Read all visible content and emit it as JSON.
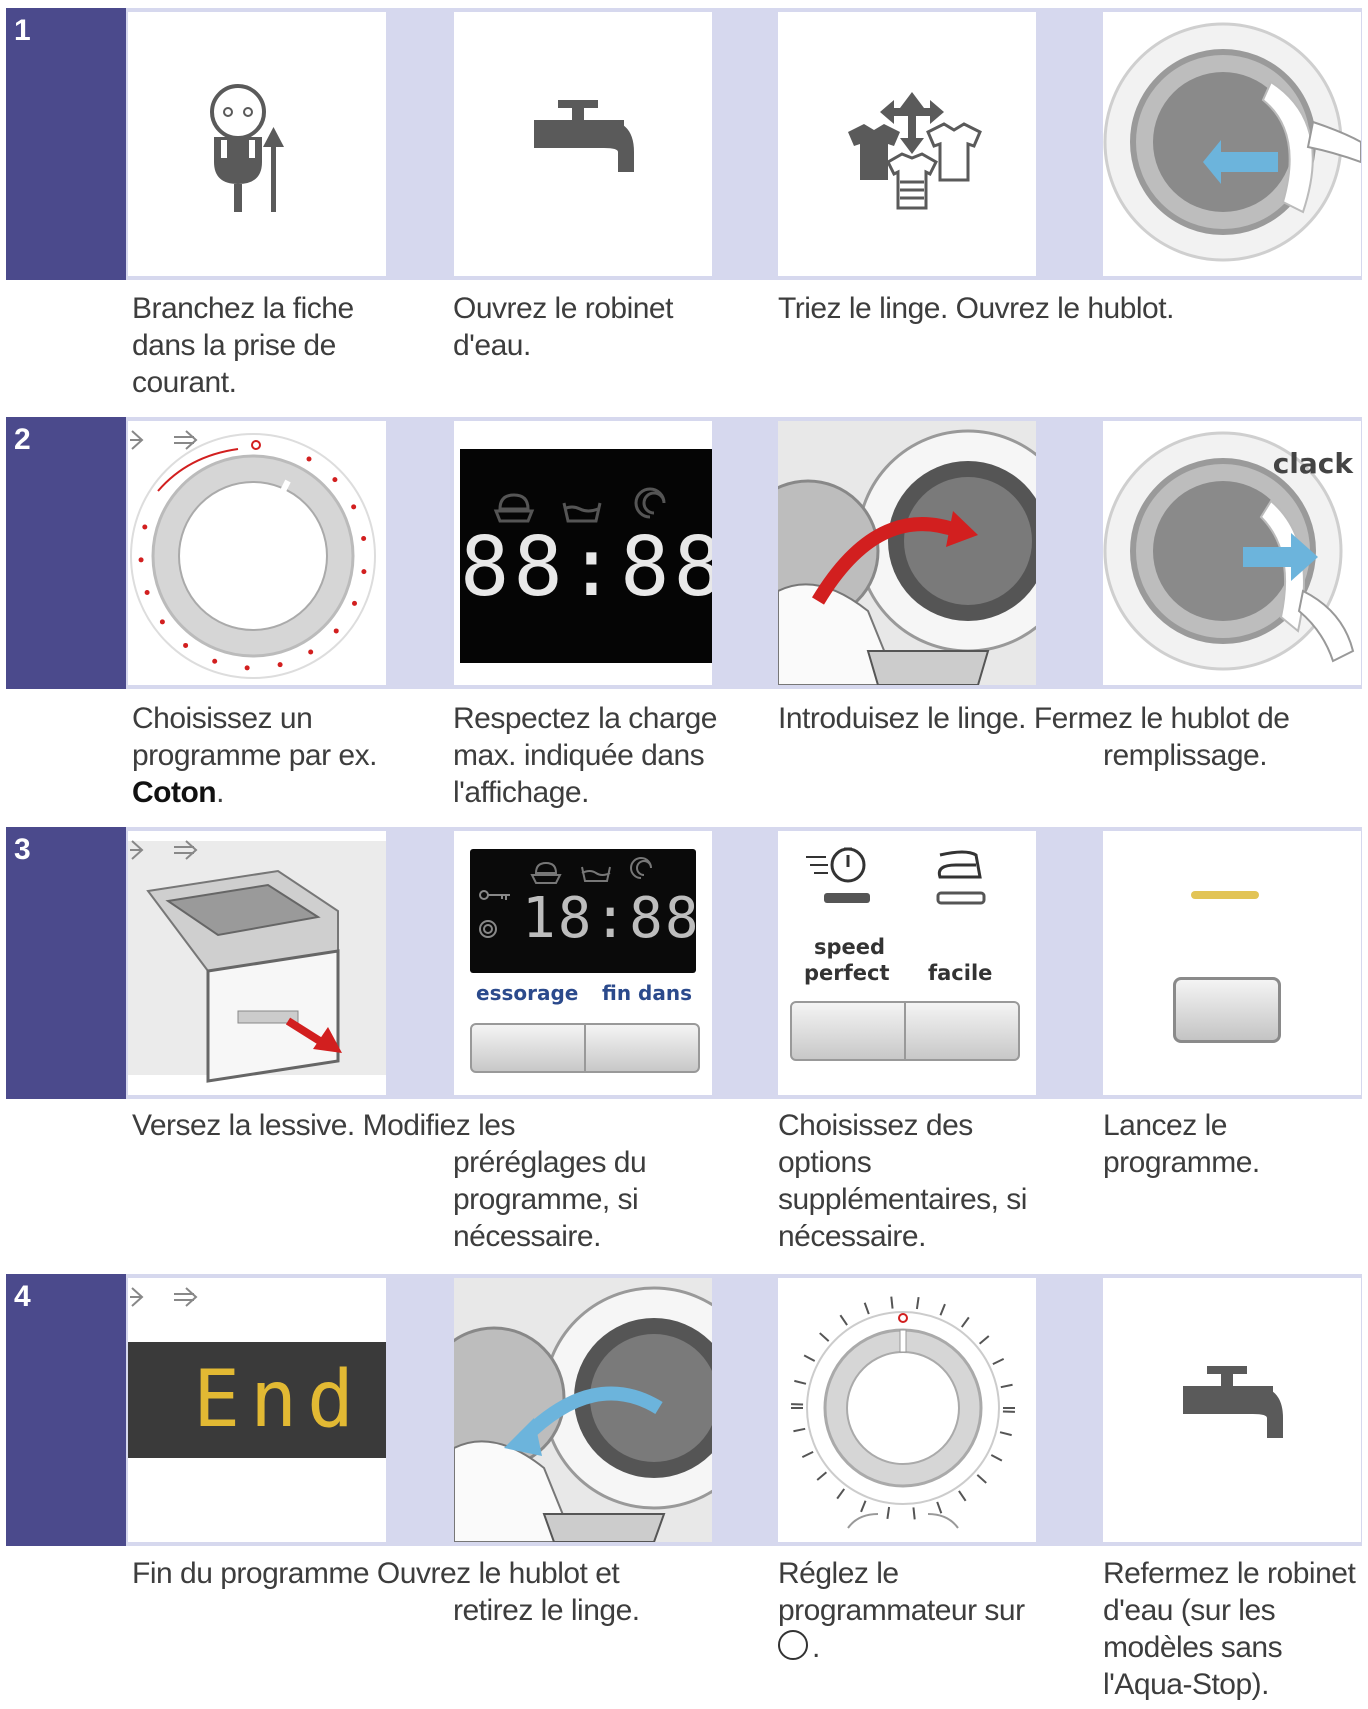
{
  "steps": [
    {
      "number": "1",
      "captions": {
        "c1": [
          "Branchez la fiche",
          "dans la prise de",
          "courant."
        ],
        "c2": [
          "Ouvrez le robinet",
          "d'eau."
        ],
        "c3": [
          "Triez le linge. Ouvrez le hublot."
        ]
      }
    },
    {
      "number": "2",
      "display_digits": "88:88",
      "clack_label": "clack",
      "captions": {
        "c1": [
          "Choisissez un",
          "programme par ex."
        ],
        "c1_bold": "Coton",
        "c1_end": ".",
        "c2": [
          "Respectez la charge",
          "max. indiquée dans",
          "l'affichage."
        ],
        "c3": [
          "Introduisez le linge. Fermez le hublot de"
        ],
        "c3b": [
          "remplissage."
        ]
      }
    },
    {
      "number": "3",
      "display_digits": "18:88",
      "buttons": {
        "spin": "essorage",
        "end_in": "fin dans",
        "speed": "speed",
        "perfect": "perfect",
        "easy": "facile"
      },
      "captions": {
        "c1": [
          "Versez la lessive. Modifiez les"
        ],
        "c2": [
          "préréglages du",
          "programme, si",
          "nécessaire."
        ],
        "c3": [
          "Choisissez des",
          "options",
          "supplémentaires, si",
          "nécessaire."
        ],
        "c4": [
          "Lancez le",
          "programme."
        ]
      }
    },
    {
      "number": "4",
      "end_text": "End",
      "captions": {
        "c1": [
          "Fin du programme Ouvrez le hublot et"
        ],
        "c2": [
          "retirez le linge."
        ],
        "c3": [
          "Réglez le",
          "programmateur sur",
          "."
        ],
        "c4": [
          "Refermez le robinet",
          "d'eau (sur les",
          "modèles sans",
          "l'Aqua-Stop)."
        ]
      }
    }
  ],
  "colors": {
    "step_bar": "#4b4a8c",
    "panel_bg": "#d6d8ee",
    "icon_gray": "#5a5a5a",
    "accent_red": "#d21f1f",
    "accent_blue": "#6cb4dc",
    "display_yellow": "#e2b933"
  }
}
